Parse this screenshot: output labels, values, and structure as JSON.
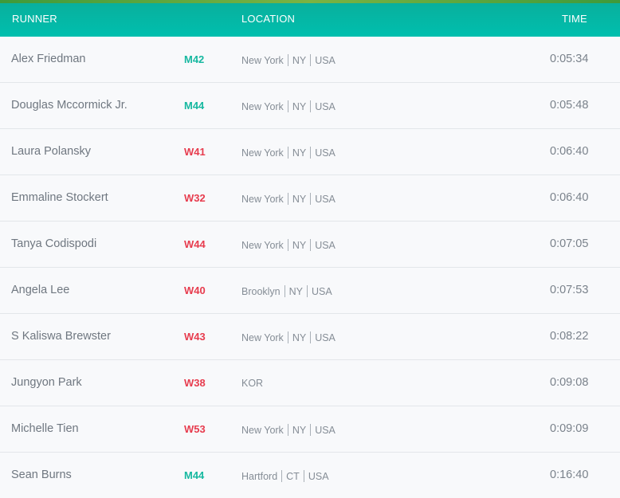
{
  "header": {
    "runner": "RUNNER",
    "location": "LOCATION",
    "time": "TIME"
  },
  "colors": {
    "header_teal": "#00bfae",
    "male_category": "#16b8a0",
    "female_category": "#e73c4e"
  },
  "rows": [
    {
      "name": "Alex Friedman",
      "category": "M42",
      "gender": "M",
      "location": [
        "New York",
        "NY",
        "USA"
      ],
      "time": "0:05:34"
    },
    {
      "name": "Douglas Mccormick Jr.",
      "category": "M44",
      "gender": "M",
      "location": [
        "New York",
        "NY",
        "USA"
      ],
      "time": "0:05:48"
    },
    {
      "name": "Laura Polansky",
      "category": "W41",
      "gender": "W",
      "location": [
        "New York",
        "NY",
        "USA"
      ],
      "time": "0:06:40"
    },
    {
      "name": "Emmaline Stockert",
      "category": "W32",
      "gender": "W",
      "location": [
        "New York",
        "NY",
        "USA"
      ],
      "time": "0:06:40"
    },
    {
      "name": "Tanya Codispodi",
      "category": "W44",
      "gender": "W",
      "location": [
        "New York",
        "NY",
        "USA"
      ],
      "time": "0:07:05"
    },
    {
      "name": "Angela Lee",
      "category": "W40",
      "gender": "W",
      "location": [
        "Brooklyn",
        "NY",
        "USA"
      ],
      "time": "0:07:53"
    },
    {
      "name": "S Kaliswa Brewster",
      "category": "W43",
      "gender": "W",
      "location": [
        "New York",
        "NY",
        "USA"
      ],
      "time": "0:08:22"
    },
    {
      "name": "Jungyon Park",
      "category": "W38",
      "gender": "W",
      "location": [
        "KOR"
      ],
      "time": "0:09:08"
    },
    {
      "name": "Michelle Tien",
      "category": "W53",
      "gender": "W",
      "location": [
        "New York",
        "NY",
        "USA"
      ],
      "time": "0:09:09"
    },
    {
      "name": "Sean Burns",
      "category": "M44",
      "gender": "M",
      "location": [
        "Hartford",
        "CT",
        "USA"
      ],
      "time": "0:16:40"
    }
  ]
}
